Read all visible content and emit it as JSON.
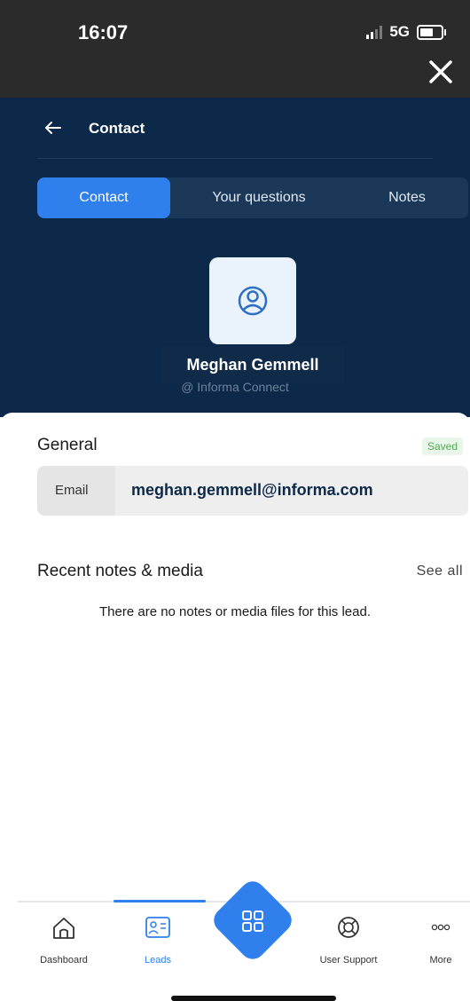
{
  "status_bar": {
    "time": "16:07",
    "network": "5G"
  },
  "header": {
    "title": "Contact"
  },
  "tabs": [
    {
      "label": "Contact",
      "active": true
    },
    {
      "label": "Your questions",
      "active": false
    },
    {
      "label": "Notes",
      "active": false
    }
  ],
  "profile": {
    "name": "Meghan Gemmell",
    "company": "@ Informa Connect"
  },
  "general": {
    "title": "General",
    "status": "Saved",
    "email_label": "Email",
    "email_value": "meghan.gemmell@informa.com"
  },
  "notes": {
    "title": "Recent notes & media",
    "see_all": "See all",
    "empty_message": "There are no notes or media files for this lead."
  },
  "bottom_nav": {
    "items": [
      {
        "label": "Dashboard",
        "icon": "home-icon",
        "active": false
      },
      {
        "label": "Leads",
        "icon": "contact-card-icon",
        "active": true
      },
      {
        "label": "User Support",
        "icon": "lifebuoy-icon",
        "active": false
      },
      {
        "label": "More",
        "icon": "more-icon",
        "active": false
      }
    ],
    "center_action_icon": "qr-scan-icon"
  },
  "colors": {
    "header_bg": "#0d2949",
    "accent": "#2f80ed",
    "status_bar_bg": "#2b2b2b",
    "saved_text": "#4caf50"
  }
}
